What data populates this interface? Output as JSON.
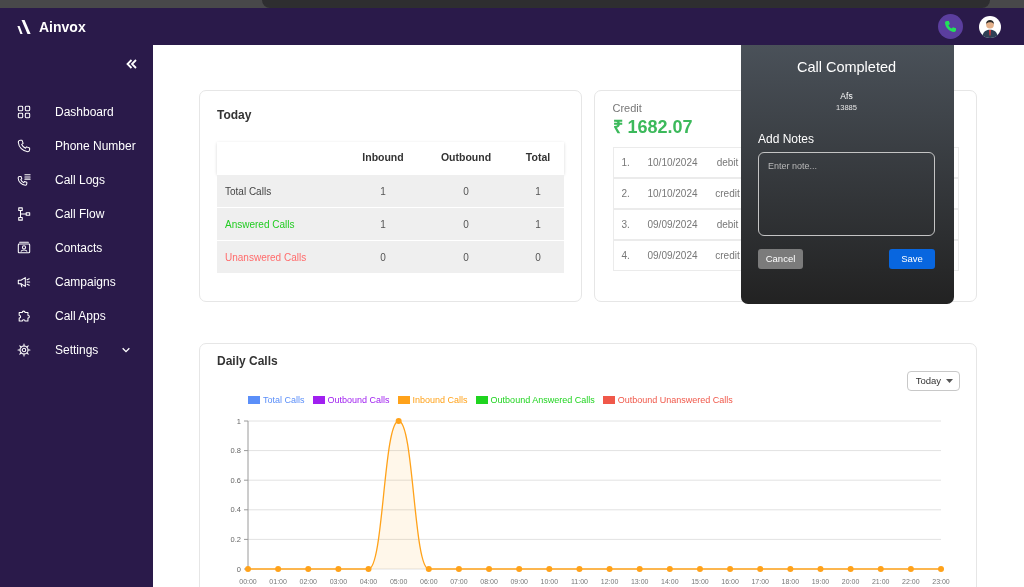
{
  "header": {
    "brand": "Ainvox"
  },
  "sidebar": {
    "items": [
      {
        "label": "Dashboard",
        "selected": false
      },
      {
        "label": "Phone Number",
        "selected": false
      },
      {
        "label": "Call Logs",
        "selected": false
      },
      {
        "label": "Call Flow",
        "selected": false
      },
      {
        "label": "Contacts",
        "selected": false
      },
      {
        "label": "Campaigns",
        "selected": false
      },
      {
        "label": "Call Apps",
        "selected": false
      },
      {
        "label": "Settings",
        "selected": false,
        "expanded": false
      }
    ]
  },
  "today": {
    "title": "Today",
    "columns": [
      "Inbound",
      "Outbound",
      "Total"
    ],
    "rows": [
      {
        "label": "Total Calls",
        "color": "#444444",
        "values": [
          "1",
          "0",
          "1"
        ]
      },
      {
        "label": "Answered Calls",
        "color": "#22cc22",
        "values": [
          "1",
          "0",
          "1"
        ]
      },
      {
        "label": "Unanswered Calls",
        "color": "#ff6b6b",
        "values": [
          "0",
          "0",
          "0"
        ]
      }
    ]
  },
  "credit": {
    "label": "Credit",
    "balance": "₹ 1682.07",
    "transactions": [
      {
        "number": "1.",
        "date": "10/10/2024",
        "type": "debit"
      },
      {
        "number": "2.",
        "date": "10/10/2024",
        "type": "credit"
      },
      {
        "number": "3.",
        "date": "09/09/2024",
        "type": "debit"
      },
      {
        "number": "4.",
        "date": "09/09/2024",
        "type": "credit"
      }
    ]
  },
  "call_dialog": {
    "title": "Call Completed",
    "caller_name": "Afs",
    "caller_number": "13885",
    "notes_label": "Add Notes",
    "notes": {
      "placeholder": "Enter note..."
    },
    "buttons": [
      {
        "label": "Cancel",
        "kind": "cancel"
      },
      {
        "label": "Save",
        "kind": "confirm"
      }
    ]
  },
  "daily_calls": {
    "title": "Daily Calls",
    "range": "Today",
    "chart_data": {
      "type": "area",
      "grid": true,
      "categories": [
        "00:00",
        "01:00",
        "02:00",
        "03:00",
        "04:00",
        "05:00",
        "06:00",
        "07:00",
        "08:00",
        "09:00",
        "10:00",
        "11:00",
        "12:00",
        "13:00",
        "14:00",
        "15:00",
        "16:00",
        "17:00",
        "18:00",
        "19:00",
        "20:00",
        "21:00",
        "22:00",
        "23:00"
      ],
      "ylim": [
        0,
        1
      ],
      "yticks": [
        0,
        0.2,
        0.4,
        0.6,
        0.8,
        1
      ],
      "series": [
        {
          "name": "Total Calls",
          "color": "#5b8ff9",
          "values": [
            null,
            null,
            null,
            null,
            null,
            null,
            null,
            null,
            null,
            null,
            null,
            null,
            null,
            null,
            null,
            null,
            null,
            null,
            null,
            null,
            null,
            null,
            null,
            null
          ]
        },
        {
          "name": "Outbound Calls",
          "color": "#a020f0",
          "values": [
            null,
            null,
            null,
            null,
            null,
            null,
            null,
            null,
            null,
            null,
            null,
            null,
            null,
            null,
            null,
            null,
            null,
            null,
            null,
            null,
            null,
            null,
            null,
            null
          ]
        },
        {
          "name": "Inbound Calls",
          "color": "#ffa21a",
          "values": [
            0,
            0,
            0,
            0,
            0,
            1,
            0,
            0,
            0,
            0,
            0,
            0,
            0,
            0,
            0,
            0,
            0,
            0,
            0,
            0,
            0,
            0,
            0,
            0
          ]
        },
        {
          "name": "Outbound Answered Calls",
          "color": "#1fd41f",
          "values": [
            null,
            null,
            null,
            null,
            null,
            null,
            null,
            null,
            null,
            null,
            null,
            null,
            null,
            null,
            null,
            null,
            null,
            null,
            null,
            null,
            null,
            null,
            null,
            null
          ]
        },
        {
          "name": "Outbound Unanswered Calls",
          "color": "#f0584a",
          "values": [
            null,
            null,
            null,
            null,
            null,
            null,
            null,
            null,
            null,
            null,
            null,
            null,
            null,
            null,
            null,
            null,
            null,
            null,
            null,
            null,
            null,
            null,
            null,
            null
          ]
        }
      ]
    }
  }
}
